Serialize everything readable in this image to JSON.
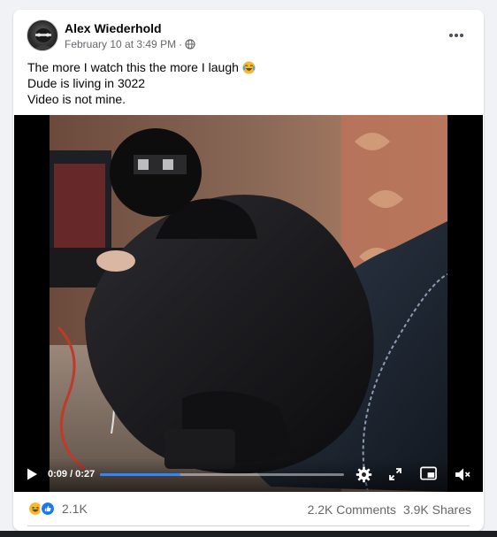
{
  "post": {
    "author": "Alex Wiederhold",
    "timestamp": "February 10 at 3:49 PM",
    "separator": "·",
    "privacy_icon": "globe-icon",
    "more_icon": "more-horizontal-icon",
    "text_lines": [
      "The more I watch this the more I laugh",
      "Dude is living in 3022",
      "Video is not mine."
    ],
    "text_emoji": "laughing-crying-emoji"
  },
  "video": {
    "time_display": "0:09 / 0:27",
    "progress": 0.33,
    "controls": [
      "play-icon",
      "settings-icon",
      "fullscreen-icon",
      "picture-in-picture-icon",
      "muted-speaker-icon"
    ]
  },
  "stats": {
    "reaction_icons": [
      "haha",
      "like"
    ],
    "reaction_count": "2.1K",
    "comments": "2.2K Comments",
    "shares": "3.9K Shares"
  },
  "colors": {
    "accent": "#2d88ff",
    "text": "#050505",
    "secondary": "#65676b",
    "background": "#f0f2f5",
    "like_blue": "#1877f2",
    "haha_yellow": "#f7b928"
  }
}
